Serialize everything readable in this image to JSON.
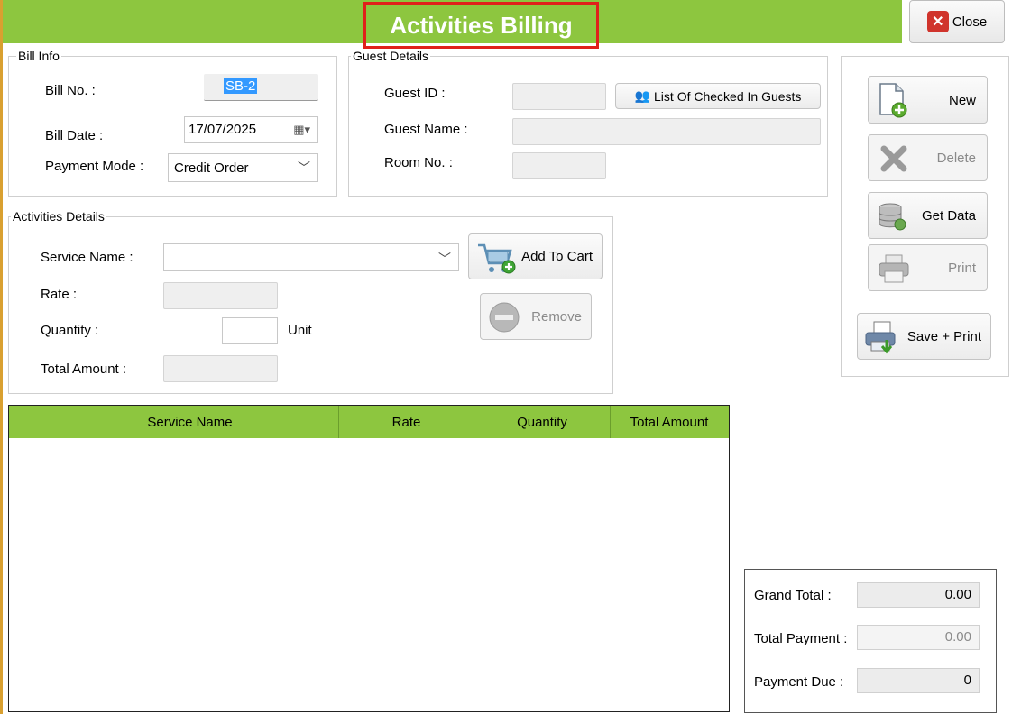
{
  "window": {
    "title": "Activities Billing",
    "close_label": "Close"
  },
  "bill_info": {
    "group_title": "Bill Info",
    "bill_no_label": "Bill No. :",
    "bill_no_value": "SB-2",
    "bill_date_label": "Bill Date :",
    "bill_date_value": "17/07/2025",
    "payment_mode_label": "Payment Mode :",
    "payment_mode_value": "Credit Order"
  },
  "guest_details": {
    "group_title": "Guest Details",
    "guest_id_label": "Guest ID :",
    "guest_id_value": "",
    "list_button_label": "List Of Checked In Guests",
    "guest_name_label": "Guest Name :",
    "guest_name_value": "",
    "room_no_label": "Room No. :",
    "room_no_value": ""
  },
  "activities": {
    "group_title": "Activities Details",
    "service_name_label": "Service Name :",
    "service_name_value": "",
    "rate_label": "Rate :",
    "rate_value": "",
    "quantity_label": "Quantity :",
    "quantity_value": "",
    "unit_label": "Unit",
    "total_amount_label": "Total Amount :",
    "total_amount_value": "",
    "add_to_cart_label": "Add To Cart",
    "remove_label": "Remove"
  },
  "actions": {
    "new_label": "New",
    "delete_label": "Delete",
    "get_data_label": "Get Data",
    "print_label": "Print",
    "save_print_label": "Save + Print"
  },
  "grid": {
    "columns": [
      "Service Name",
      "Rate",
      "Quantity",
      "Total Amount"
    ],
    "rows": []
  },
  "totals": {
    "grand_total_label": "Grand Total :",
    "grand_total_value": "0.00",
    "total_payment_label": "Total Payment :",
    "total_payment_value": "0.00",
    "payment_due_label": "Payment Due :",
    "payment_due_value": "0"
  },
  "colors": {
    "accent_green": "#8dc63f",
    "highlight_red": "#e0201b",
    "selection_blue": "#3399ff"
  }
}
